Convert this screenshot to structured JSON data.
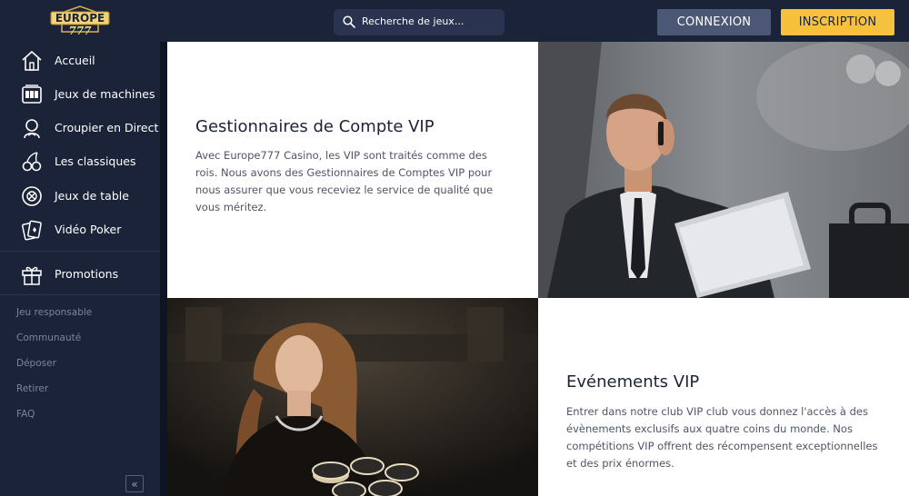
{
  "header": {
    "logo_text_top": "EUROPE",
    "logo_text_bottom": "777",
    "search_placeholder": "Recherche de jeux...",
    "login_label": "CONNEXION",
    "signup_label": "INSCRIPTION"
  },
  "sidebar": {
    "items": [
      {
        "label": "Accueil",
        "icon": "home-icon"
      },
      {
        "label": "Jeux de machines",
        "icon": "slot-machine-icon"
      },
      {
        "label": "Croupier en Direct",
        "icon": "dealer-icon"
      },
      {
        "label": "Les classiques",
        "icon": "cherries-icon"
      },
      {
        "label": "Jeux de table",
        "icon": "roulette-chip-icon"
      },
      {
        "label": "Vidéo Poker",
        "icon": "cards-icon"
      }
    ],
    "promotions": {
      "label": "Promotions",
      "icon": "gift-icon"
    },
    "footer_links": [
      "Jeu responsable",
      "Communauté",
      "Déposer",
      "Retirer",
      "FAQ"
    ],
    "collapse_label": "«"
  },
  "content": {
    "vip_managers": {
      "title": "Gestionnaires de Compte VIP",
      "body": "Avec Europe777 Casino, les VIP sont traités comme des rois. Nous avons des Gestionnaires de Comptes VIP pour nous assurer que vous receviez le service de qualité que vous méritez."
    },
    "vip_events": {
      "title": "Evénements VIP",
      "body": "Entrer dans notre club VIP club vous donnez l'accès à des évènements exclusifs aux quatre coins du monde. Nos compétitions VIP offrent des récompensent exceptionnelles et des prix énormes."
    }
  },
  "colors": {
    "navy": "#1b2338",
    "accent_yellow": "#f6c23e",
    "login_blue": "#4b5775"
  }
}
